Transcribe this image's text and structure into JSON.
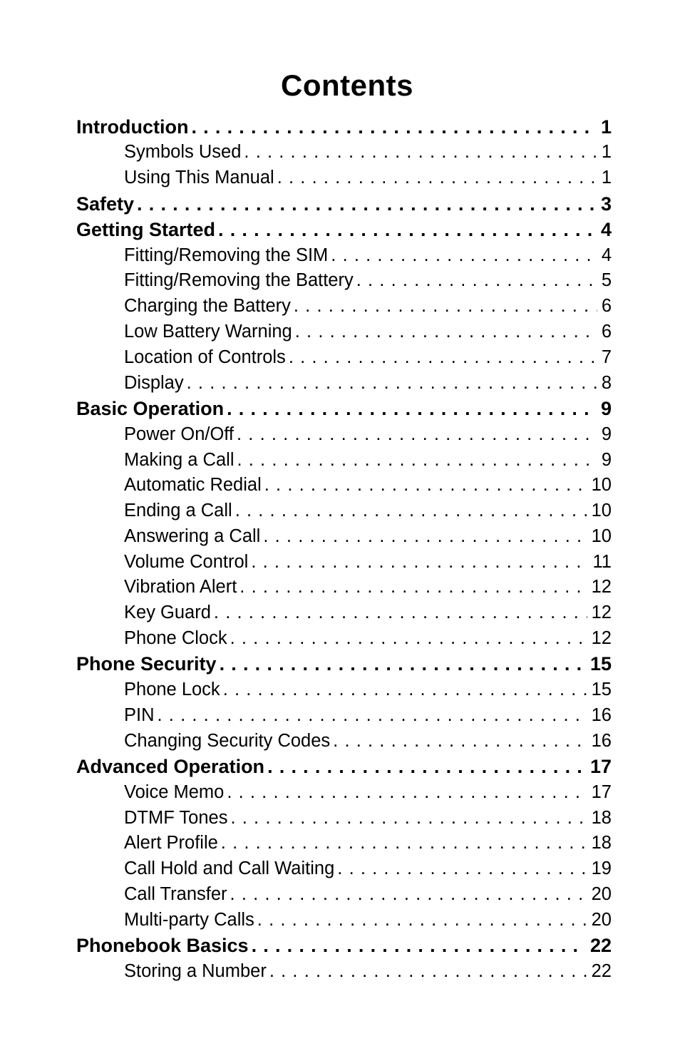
{
  "title": "Contents",
  "entries": [
    {
      "level": 1,
      "label": "Introduction",
      "page": "1"
    },
    {
      "level": 2,
      "label": "Symbols Used",
      "page": "1"
    },
    {
      "level": 2,
      "label": "Using This Manual",
      "page": "1"
    },
    {
      "level": 1,
      "label": "Safety",
      "page": "3"
    },
    {
      "level": 1,
      "label": "Getting Started",
      "page": "4"
    },
    {
      "level": 2,
      "label": "Fitting/Removing the SIM",
      "page": "4"
    },
    {
      "level": 2,
      "label": "Fitting/Removing the Battery",
      "page": "5"
    },
    {
      "level": 2,
      "label": "Charging the Battery",
      "page": "6"
    },
    {
      "level": 2,
      "label": "Low Battery Warning",
      "page": "6"
    },
    {
      "level": 2,
      "label": "Location of Controls",
      "page": "7"
    },
    {
      "level": 2,
      "label": "Display",
      "page": "8"
    },
    {
      "level": 1,
      "label": "Basic Operation",
      "page": "9"
    },
    {
      "level": 2,
      "label": "Power On/Off",
      "page": "9"
    },
    {
      "level": 2,
      "label": "Making a Call",
      "page": "9"
    },
    {
      "level": 2,
      "label": "Automatic Redial",
      "page": "10"
    },
    {
      "level": 2,
      "label": "Ending a Call",
      "page": "10"
    },
    {
      "level": 2,
      "label": "Answering a Call",
      "page": "10"
    },
    {
      "level": 2,
      "label": "Volume Control",
      "page": "11"
    },
    {
      "level": 2,
      "label": "Vibration Alert",
      "page": "12"
    },
    {
      "level": 2,
      "label": "Key Guard",
      "page": "12"
    },
    {
      "level": 2,
      "label": "Phone Clock",
      "page": "12"
    },
    {
      "level": 1,
      "label": "Phone Security",
      "page": "15"
    },
    {
      "level": 2,
      "label": "Phone Lock",
      "page": "15"
    },
    {
      "level": 2,
      "label": "PIN",
      "page": "16"
    },
    {
      "level": 2,
      "label": "Changing Security Codes",
      "page": "16"
    },
    {
      "level": 1,
      "label": "Advanced Operation",
      "page": "17"
    },
    {
      "level": 2,
      "label": "Voice Memo",
      "page": "17"
    },
    {
      "level": 2,
      "label": "DTMF Tones",
      "page": "18"
    },
    {
      "level": 2,
      "label": "Alert Profile",
      "page": "18"
    },
    {
      "level": 2,
      "label": "Call Hold and Call Waiting",
      "page": "19"
    },
    {
      "level": 2,
      "label": "Call Transfer",
      "page": "20"
    },
    {
      "level": 2,
      "label": "Multi-party Calls",
      "page": "20"
    },
    {
      "level": 1,
      "label": "Phonebook Basics",
      "page": "22"
    },
    {
      "level": 2,
      "label": "Storing a Number",
      "page": "22"
    }
  ]
}
